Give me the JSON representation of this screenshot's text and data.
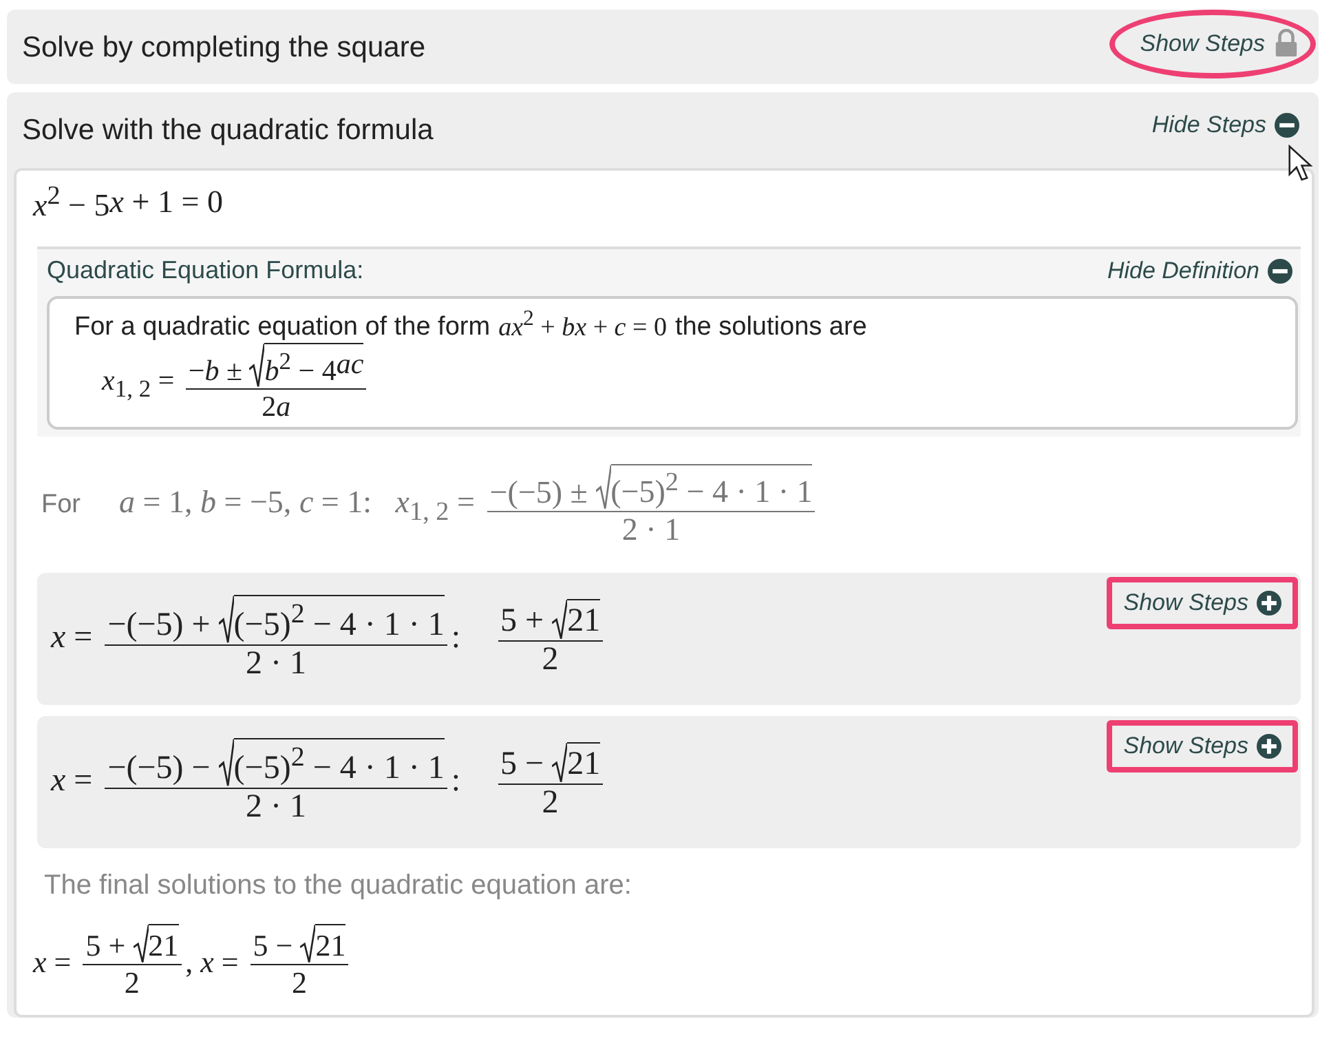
{
  "sections": [
    {
      "title": "Solve by completing the square",
      "expanded": false,
      "toggle": {
        "label": "Show Steps",
        "kind": "locked",
        "highlighted": true
      }
    },
    {
      "title": "Solve with the quadratic formula",
      "expanded": true,
      "toggle": {
        "label": "Hide Steps",
        "kind": "collapse",
        "highlighted": false
      },
      "body": {
        "equation": [
          "*x*$^{2}$ − 5",
          "*x*",
          " + 1 = 0"
        ],
        "definition": {
          "title": "Quadratic Equation Formula:",
          "toggle": {
            "label": "Hide Definition",
            "kind": "collapse",
            "highlighted": false
          },
          "intro": "For a quadratic equation of the form",
          "intro_math": [
            "*ax*$^{2}$ + *bx* + *c* = 0"
          ],
          "outro": "the solutions are",
          "formula": [
            "*x*$_{1, 2}$ = ",
            {
              "kind": "frac",
              "num": [
                "−*b* ± ",
                {
                  "kind": "sqrt",
                  "body": [
                    "*b*$^{2}$ − 4",
                    "*ac*"
                  ]
                }
              ],
              "den": [
                "2",
                "*a*"
              ]
            }
          ]
        },
        "substitution": {
          "label": "For",
          "math": [
            "*a* = 1, *b* = −5, *c* = 1:   *x*$_{1, 2}$ = ",
            {
              "kind": "frac",
              "num": [
                "−(−5) ± ",
                {
                  "kind": "sqrt",
                  "body": [
                    "(−5)$^{2}$ − 4 · 1 · 1"
                  ]
                }
              ],
              "den": [
                "2 · 1"
              ]
            }
          ]
        },
        "steps": [
          {
            "math": [
              "*x* = ",
              {
                "kind": "frac",
                "num": [
                  "−(−5) + ",
                  {
                    "kind": "sqrt",
                    "body": [
                      "(−5)$^{2}$ − 4 · 1 · 1"
                    ]
                  }
                ],
                "den": [
                  "2 · 1"
                ]
              },
              ":    ",
              {
                "kind": "frac",
                "num": [
                  "5 + ",
                  {
                    "kind": "sqrt",
                    "body": [
                      "21"
                    ]
                  }
                ],
                "den": [
                  "2"
                ]
              }
            ],
            "toggle": {
              "label": "Show Steps",
              "kind": "expand",
              "highlighted": true
            }
          },
          {
            "math": [
              "*x* = ",
              {
                "kind": "frac",
                "num": [
                  "−(−5) − ",
                  {
                    "kind": "sqrt",
                    "body": [
                      "(−5)$^{2}$ − 4 · 1 · 1"
                    ]
                  }
                ],
                "den": [
                  "2 · 1"
                ]
              },
              ":    ",
              {
                "kind": "frac",
                "num": [
                  "5 − ",
                  {
                    "kind": "sqrt",
                    "body": [
                      "21"
                    ]
                  }
                ],
                "den": [
                  "2"
                ]
              }
            ],
            "toggle": {
              "label": "Show Steps",
              "kind": "expand",
              "highlighted": true
            }
          }
        ],
        "final_label": "The final solutions to the quadratic equation are:",
        "final": [
          "*x* = ",
          {
            "kind": "frac",
            "num": [
              "5 + ",
              {
                "kind": "sqrt",
                "body": [
                  "21"
                ]
              }
            ],
            "den": [
              "2"
            ]
          },
          ", *x* = ",
          {
            "kind": "frac",
            "num": [
              "5 − ",
              {
                "kind": "sqrt",
                "body": [
                  "21"
                ]
              }
            ],
            "den": [
              "2"
            ]
          }
        ]
      }
    }
  ]
}
